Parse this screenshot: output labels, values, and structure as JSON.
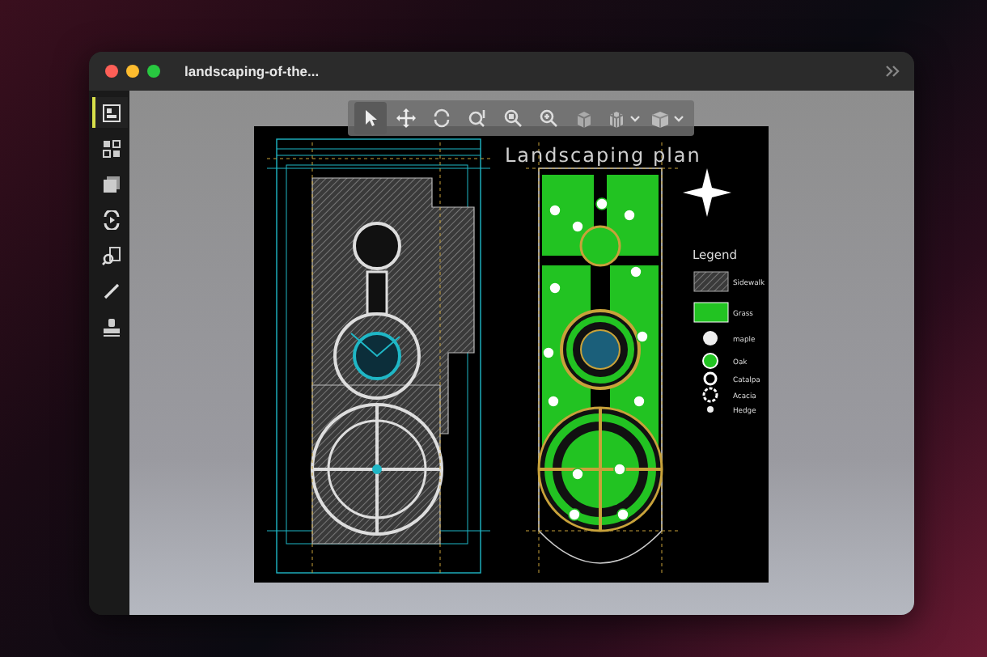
{
  "window": {
    "title": "landscaping-of-the..."
  },
  "sidebar": {
    "items": [
      {
        "kind": "layout",
        "selected": true
      },
      {
        "kind": "grid",
        "selected": false
      },
      {
        "kind": "layers",
        "selected": false
      },
      {
        "kind": "sync",
        "selected": false
      },
      {
        "kind": "scan",
        "selected": false
      },
      {
        "kind": "pen",
        "selected": false
      },
      {
        "kind": "stamp",
        "selected": false
      }
    ]
  },
  "toolbar": {
    "tools": [
      {
        "kind": "pointer",
        "selected": true,
        "has_menu": false
      },
      {
        "kind": "move",
        "selected": false,
        "has_menu": false
      },
      {
        "kind": "rotate",
        "selected": false,
        "has_menu": false
      },
      {
        "kind": "zoom-window",
        "selected": false,
        "has_menu": false
      },
      {
        "kind": "zoom-fit",
        "selected": false,
        "has_menu": false
      },
      {
        "kind": "zoom",
        "selected": false,
        "has_menu": false
      },
      {
        "kind": "cube",
        "selected": false,
        "has_menu": false
      },
      {
        "kind": "cube-views",
        "selected": false,
        "has_menu": true
      },
      {
        "kind": "box",
        "selected": false,
        "has_menu": true
      }
    ]
  },
  "drawing": {
    "title": "Landscaping plan",
    "legend": {
      "title": "Legend",
      "items": [
        {
          "kind": "hatch",
          "label": "Sidewalk"
        },
        {
          "kind": "fill",
          "label": "Grass"
        },
        {
          "kind": "dot",
          "label": "maple"
        },
        {
          "kind": "tree",
          "label": "Oak"
        },
        {
          "kind": "small-tree",
          "label": "Catalpa"
        },
        {
          "kind": "ring-tree",
          "label": "Acacia"
        },
        {
          "kind": "small-dot",
          "label": "Hedge"
        }
      ]
    }
  }
}
